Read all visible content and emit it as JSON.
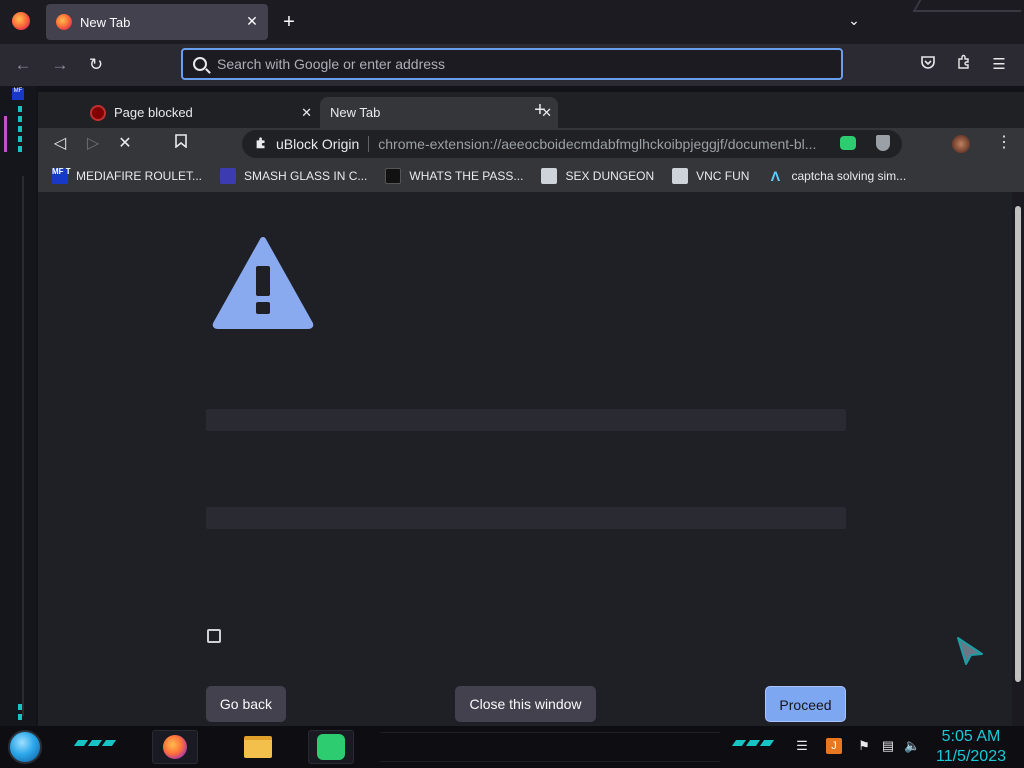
{
  "outer_browser": {
    "tab_title": "New Tab",
    "address_placeholder": "Search with Google or enter address"
  },
  "inner_browser": {
    "tabs": [
      {
        "label": "Page blocked"
      },
      {
        "label": "New Tab"
      }
    ],
    "omnibox": {
      "extension_name": "uBlock Origin",
      "url": "chrome-extension://aeeocboidecmdabfmglhckoibpjeggjf/document-bl..."
    },
    "bookmarks": [
      {
        "label": "MEDIAFIRE ROULET...",
        "icon": "mediafire-icon"
      },
      {
        "label": "SMASH GLASS IN C...",
        "icon": "smash-glass-icon"
      },
      {
        "label": "WHATS THE PASS...",
        "icon": "lock-icon"
      },
      {
        "label": "SEX DUNGEON",
        "icon": "cube-icon"
      },
      {
        "label": "VNC FUN",
        "icon": "cube-icon"
      },
      {
        "label": "captcha solving sim...",
        "icon": "lambda-icon"
      }
    ]
  },
  "page": {
    "buttons": {
      "go_back": "Go back",
      "close_window": "Close this window",
      "proceed": "Proceed"
    }
  },
  "taskbar": {
    "time": "5:05 AM",
    "date": "11/5/2023"
  },
  "colors": {
    "accent_blue": "#7ea7f2",
    "warning_icon": "#8aaaf0",
    "cyan_accent": "#17c4c4"
  }
}
